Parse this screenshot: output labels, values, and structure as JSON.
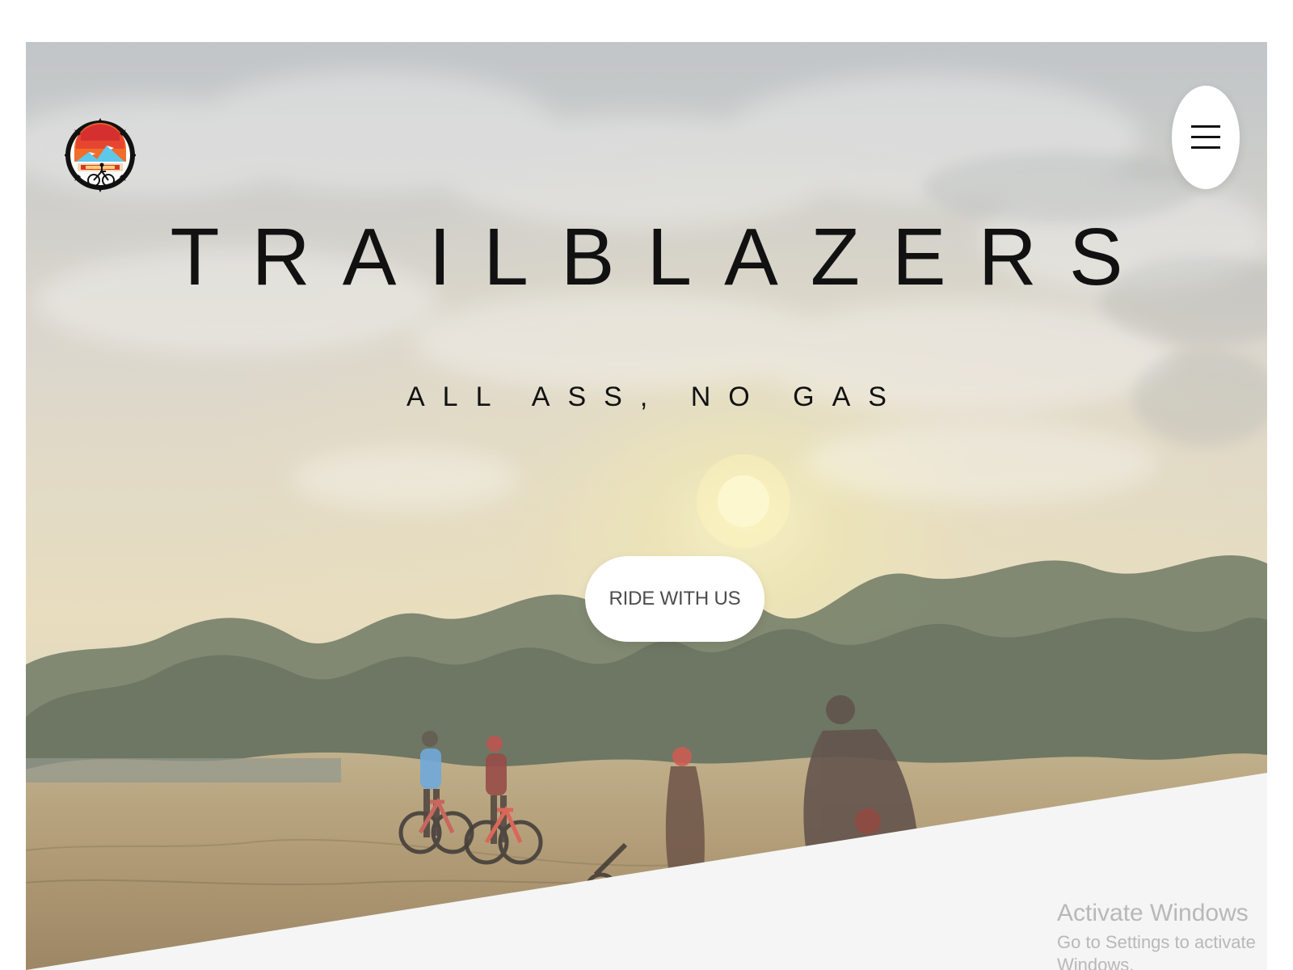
{
  "app": {
    "title": "TRAILBLAZERS",
    "tagline": "ALL ASS, NO GAS",
    "cta_label": "RIDE WITH US",
    "menu_icon": "hamburger-icon",
    "logo_icon": "trailblazers-logo-icon"
  },
  "watermark": {
    "line1": "Activate Windows",
    "line2": "Go to Settings to activate Windows."
  },
  "colors": {
    "page_background": "#ffffff",
    "hero_overlay": "#ffffff",
    "title": "#111111",
    "button_background": "#ffffff",
    "button_text": "#4d4d4d",
    "watermark": "#b8b8b8",
    "slant_background": "#f5f5f5",
    "logo_orange": "#f26c2b",
    "logo_red": "#d62f2f",
    "logo_blue": "#5dc8ea"
  }
}
